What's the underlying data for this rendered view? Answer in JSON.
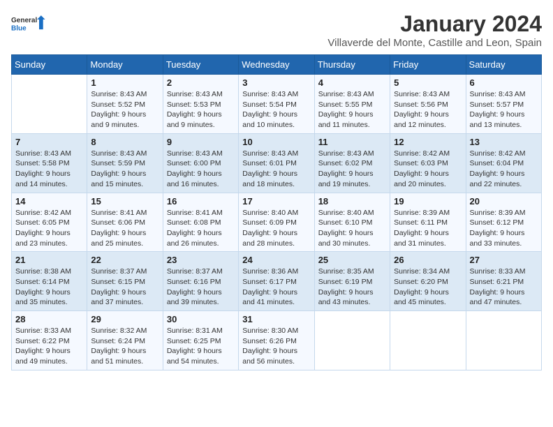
{
  "header": {
    "logo_general": "General",
    "logo_blue": "Blue",
    "month": "January 2024",
    "location": "Villaverde del Monte, Castille and Leon, Spain"
  },
  "columns": [
    "Sunday",
    "Monday",
    "Tuesday",
    "Wednesday",
    "Thursday",
    "Friday",
    "Saturday"
  ],
  "rows": [
    [
      {
        "day": "",
        "detail": ""
      },
      {
        "day": "1",
        "detail": "Sunrise: 8:43 AM\nSunset: 5:52 PM\nDaylight: 9 hours\nand 9 minutes."
      },
      {
        "day": "2",
        "detail": "Sunrise: 8:43 AM\nSunset: 5:53 PM\nDaylight: 9 hours\nand 9 minutes."
      },
      {
        "day": "3",
        "detail": "Sunrise: 8:43 AM\nSunset: 5:54 PM\nDaylight: 9 hours\nand 10 minutes."
      },
      {
        "day": "4",
        "detail": "Sunrise: 8:43 AM\nSunset: 5:55 PM\nDaylight: 9 hours\nand 11 minutes."
      },
      {
        "day": "5",
        "detail": "Sunrise: 8:43 AM\nSunset: 5:56 PM\nDaylight: 9 hours\nand 12 minutes."
      },
      {
        "day": "6",
        "detail": "Sunrise: 8:43 AM\nSunset: 5:57 PM\nDaylight: 9 hours\nand 13 minutes."
      }
    ],
    [
      {
        "day": "7",
        "detail": "Sunrise: 8:43 AM\nSunset: 5:58 PM\nDaylight: 9 hours\nand 14 minutes."
      },
      {
        "day": "8",
        "detail": "Sunrise: 8:43 AM\nSunset: 5:59 PM\nDaylight: 9 hours\nand 15 minutes."
      },
      {
        "day": "9",
        "detail": "Sunrise: 8:43 AM\nSunset: 6:00 PM\nDaylight: 9 hours\nand 16 minutes."
      },
      {
        "day": "10",
        "detail": "Sunrise: 8:43 AM\nSunset: 6:01 PM\nDaylight: 9 hours\nand 18 minutes."
      },
      {
        "day": "11",
        "detail": "Sunrise: 8:43 AM\nSunset: 6:02 PM\nDaylight: 9 hours\nand 19 minutes."
      },
      {
        "day": "12",
        "detail": "Sunrise: 8:42 AM\nSunset: 6:03 PM\nDaylight: 9 hours\nand 20 minutes."
      },
      {
        "day": "13",
        "detail": "Sunrise: 8:42 AM\nSunset: 6:04 PM\nDaylight: 9 hours\nand 22 minutes."
      }
    ],
    [
      {
        "day": "14",
        "detail": "Sunrise: 8:42 AM\nSunset: 6:05 PM\nDaylight: 9 hours\nand 23 minutes."
      },
      {
        "day": "15",
        "detail": "Sunrise: 8:41 AM\nSunset: 6:06 PM\nDaylight: 9 hours\nand 25 minutes."
      },
      {
        "day": "16",
        "detail": "Sunrise: 8:41 AM\nSunset: 6:08 PM\nDaylight: 9 hours\nand 26 minutes."
      },
      {
        "day": "17",
        "detail": "Sunrise: 8:40 AM\nSunset: 6:09 PM\nDaylight: 9 hours\nand 28 minutes."
      },
      {
        "day": "18",
        "detail": "Sunrise: 8:40 AM\nSunset: 6:10 PM\nDaylight: 9 hours\nand 30 minutes."
      },
      {
        "day": "19",
        "detail": "Sunrise: 8:39 AM\nSunset: 6:11 PM\nDaylight: 9 hours\nand 31 minutes."
      },
      {
        "day": "20",
        "detail": "Sunrise: 8:39 AM\nSunset: 6:12 PM\nDaylight: 9 hours\nand 33 minutes."
      }
    ],
    [
      {
        "day": "21",
        "detail": "Sunrise: 8:38 AM\nSunset: 6:14 PM\nDaylight: 9 hours\nand 35 minutes."
      },
      {
        "day": "22",
        "detail": "Sunrise: 8:37 AM\nSunset: 6:15 PM\nDaylight: 9 hours\nand 37 minutes."
      },
      {
        "day": "23",
        "detail": "Sunrise: 8:37 AM\nSunset: 6:16 PM\nDaylight: 9 hours\nand 39 minutes."
      },
      {
        "day": "24",
        "detail": "Sunrise: 8:36 AM\nSunset: 6:17 PM\nDaylight: 9 hours\nand 41 minutes."
      },
      {
        "day": "25",
        "detail": "Sunrise: 8:35 AM\nSunset: 6:19 PM\nDaylight: 9 hours\nand 43 minutes."
      },
      {
        "day": "26",
        "detail": "Sunrise: 8:34 AM\nSunset: 6:20 PM\nDaylight: 9 hours\nand 45 minutes."
      },
      {
        "day": "27",
        "detail": "Sunrise: 8:33 AM\nSunset: 6:21 PM\nDaylight: 9 hours\nand 47 minutes."
      }
    ],
    [
      {
        "day": "28",
        "detail": "Sunrise: 8:33 AM\nSunset: 6:22 PM\nDaylight: 9 hours\nand 49 minutes."
      },
      {
        "day": "29",
        "detail": "Sunrise: 8:32 AM\nSunset: 6:24 PM\nDaylight: 9 hours\nand 51 minutes."
      },
      {
        "day": "30",
        "detail": "Sunrise: 8:31 AM\nSunset: 6:25 PM\nDaylight: 9 hours\nand 54 minutes."
      },
      {
        "day": "31",
        "detail": "Sunrise: 8:30 AM\nSunset: 6:26 PM\nDaylight: 9 hours\nand 56 minutes."
      },
      {
        "day": "",
        "detail": ""
      },
      {
        "day": "",
        "detail": ""
      },
      {
        "day": "",
        "detail": ""
      }
    ]
  ]
}
